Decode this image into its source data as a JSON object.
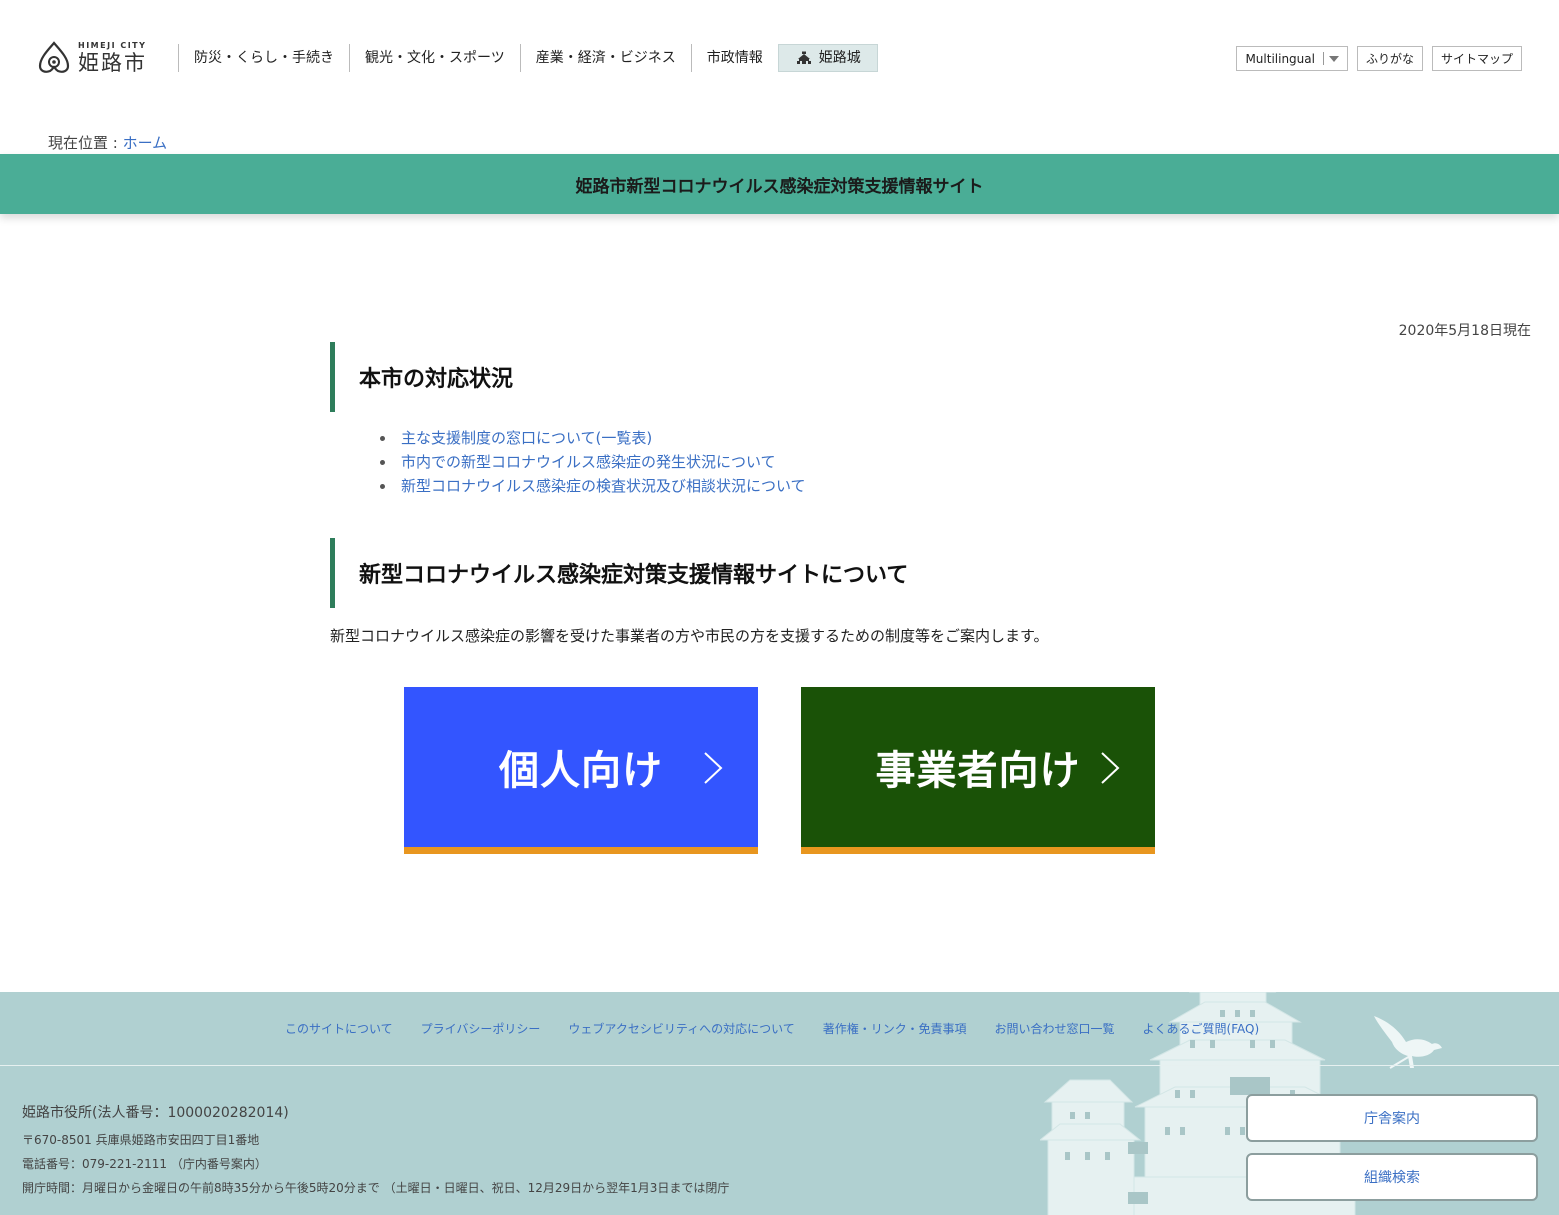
{
  "header": {
    "logo": {
      "en": "HIMEJI CITY",
      "ja": "姫路市"
    },
    "nav": [
      {
        "label": "防災・くらし・手続き"
      },
      {
        "label": "観光・文化・スポーツ"
      },
      {
        "label": "産業・経済・ビジネス"
      },
      {
        "label": "市政情報"
      },
      {
        "label": "姫路城"
      }
    ],
    "utils": {
      "multilingual": "Multilingual",
      "furigana": "ふりがな",
      "sitemap": "サイトマップ"
    }
  },
  "breadcrumb": {
    "prefix": "現在位置 : ",
    "home": "ホーム"
  },
  "banner": {
    "title": "姫路市新型コロナウイルス感染症対策支援情報サイト"
  },
  "date": "2020年5月18日現在",
  "section_status": {
    "heading": "本市の対応状況",
    "links": [
      "主な支援制度の窓口について(一覧表)",
      "市内での新型コロナウイルス感染症の発生状況について",
      "新型コロナウイルス感染症の検査状況及び相談状況について"
    ]
  },
  "section_about": {
    "heading": "新型コロナウイルス感染症対策支援情報サイトについて",
    "lead": "新型コロナウイルス感染症の影響を受けた事業者の方や市民の方を支援するための制度等をご案内します。"
  },
  "cta": {
    "personal": "個人向け",
    "business": "事業者向け"
  },
  "colors": {
    "banner": "#4aad96",
    "personal": "#3355ff",
    "business": "#1a5207",
    "accent": "#e8961f",
    "footer": "#b0d0d1",
    "link": "#3a6fc4"
  },
  "footer": {
    "links": [
      "このサイトについて",
      "プライバシーポリシー",
      "ウェブアクセシビリティへの対応について",
      "著作権・リンク・免責事項",
      "お問い合わせ窓口一覧",
      "よくあるご質問(FAQ)"
    ],
    "name": "姫路市役所(法人番号：1000020282014)",
    "address": "〒670-8501 兵庫県姫路市安田四丁目1番地",
    "phone": "電話番号：079-221-2111 （庁内番号案内）",
    "hours": "開庁時間：月曜日から金曜日の午前8時35分から午後5時20分まで （土曜日・日曜日、祝日、12月29日から翌年1月3日までは閉庁",
    "buttons": [
      "庁舎案内",
      "組織検索"
    ]
  }
}
